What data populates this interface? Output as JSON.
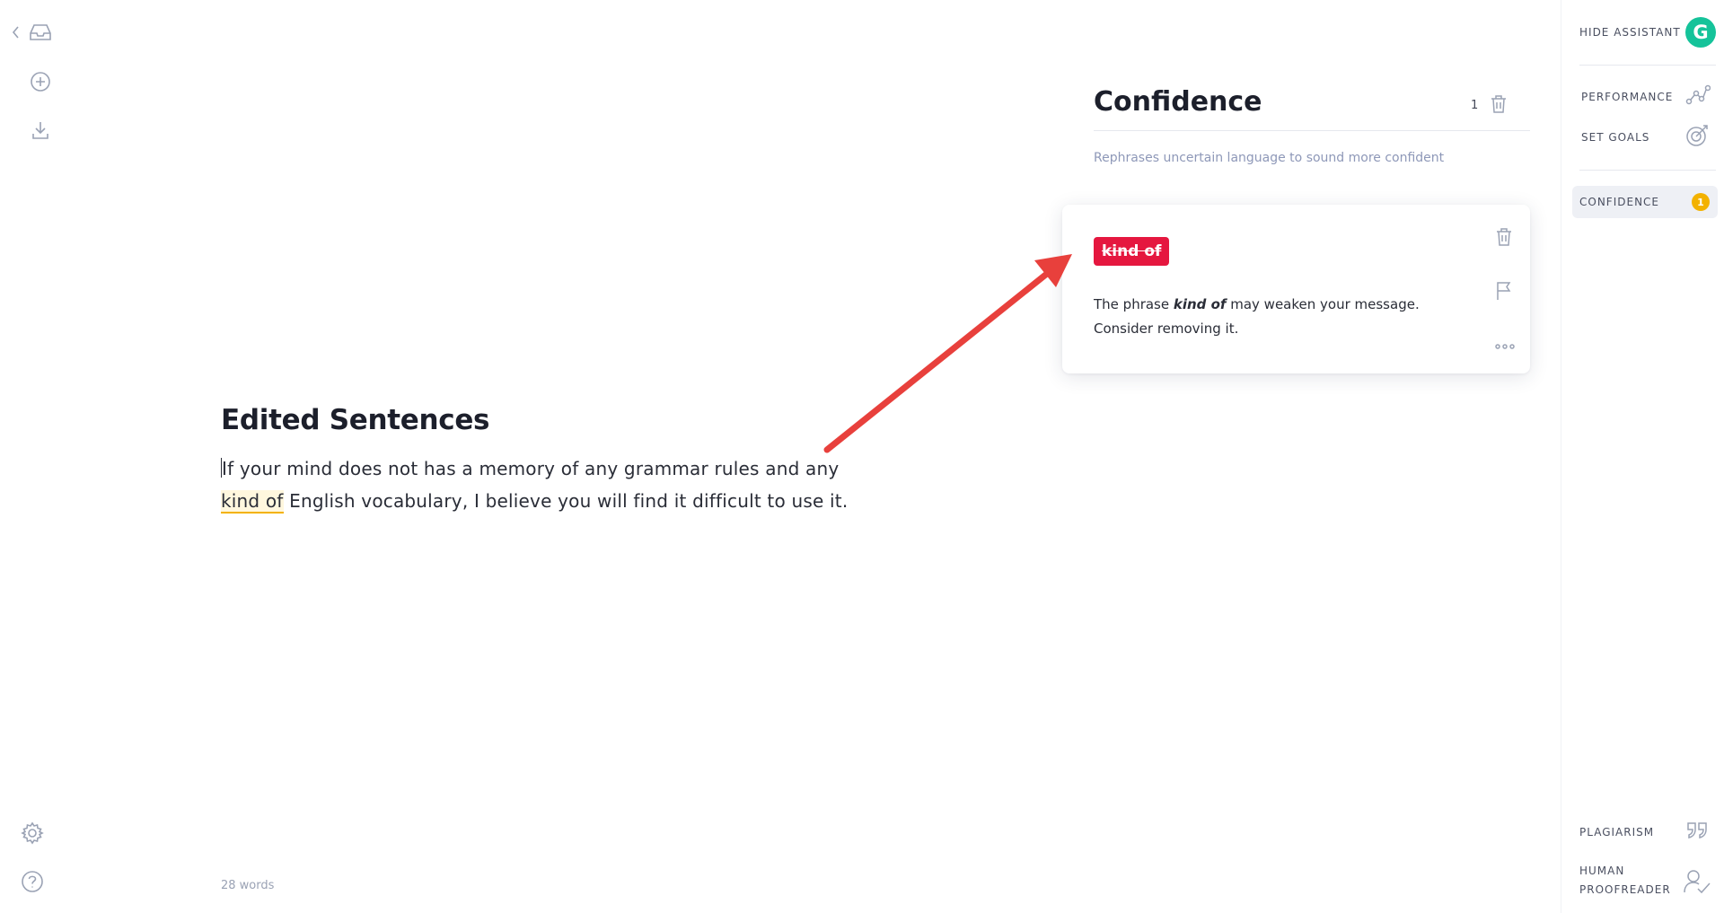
{
  "editor": {
    "title": "Edited Sentences",
    "text_before": "If your mind does not has a memory of any grammar rules and any ",
    "flagged_phrase": "kind of",
    "text_after": " English vocabulary, I believe you will find it difficult to use it.",
    "word_count": "28 words"
  },
  "left_rail": {
    "icons": [
      "back-chevron-icon",
      "inbox-icon",
      "plus-circle-icon",
      "download-icon",
      "gear-icon",
      "help-icon"
    ]
  },
  "panel": {
    "title": "Confidence",
    "count": "1",
    "description": "Rephrases uncertain language to sound more confident"
  },
  "card": {
    "chip": "kind of",
    "text_prefix": "The phrase ",
    "text_phrase": "kind of",
    "text_suffix": " may weaken your message. Consider removing it."
  },
  "sidebar": {
    "hide_assistant": "HIDE ASSISTANT",
    "logo": "G",
    "performance": "PERFORMANCE",
    "set_goals": "SET GOALS",
    "confidence": "CONFIDENCE",
    "confidence_count": "1",
    "plagiarism": "PLAGIARISM",
    "human_line1": "HUMAN",
    "human_line2": "PROOFREADER"
  },
  "colors": {
    "accent_green": "#15c39a",
    "badge_yellow": "#f3b200",
    "chip_red": "#e5173f",
    "arrow_red": "#e8403c"
  }
}
